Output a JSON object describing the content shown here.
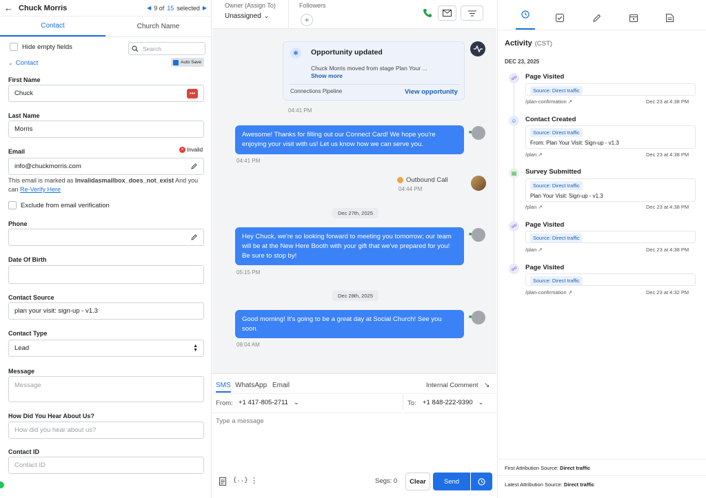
{
  "contact_header": {
    "name": "Chuck Morris",
    "current": "9 of",
    "total": "15",
    "selected_label": "selected"
  },
  "tabs": [
    "Contact",
    "Church Name"
  ],
  "toolbar": {
    "hide_empty": "Hide empty fields",
    "search_placeholder": "Search",
    "auto_save": "Auto Save",
    "section": "Contact"
  },
  "fields": {
    "first_name": {
      "label": "First Name",
      "value": "Chuck"
    },
    "last_name": {
      "label": "Last Name",
      "value": "Morris"
    },
    "email": {
      "label": "Email",
      "value": "info@chuckmorris.com",
      "badge": "Invalid",
      "note_a": "This email is marked as ",
      "note_bold": "Invalidasmailbox_does_not_exist",
      "note_b": " And you can ",
      "link": "Re-Verify Here"
    },
    "exclude_label": "Exclude from email verification",
    "phone": {
      "label": "Phone",
      "value": ""
    },
    "dob": {
      "label": "Date Of Birth",
      "value": ""
    },
    "source": {
      "label": "Contact Source",
      "value": "plan your visit: sign-up - v1.3"
    },
    "type": {
      "label": "Contact Type",
      "value": "Lead"
    },
    "message": {
      "label": "Message",
      "placeholder": "Message"
    },
    "hear": {
      "label": "How Did You Hear About Us?",
      "placeholder": "How did you hear about us?"
    },
    "cid": {
      "label": "Contact ID",
      "placeholder": "Contact ID"
    }
  },
  "mid_header": {
    "owner_label": "Owner (Assign To)",
    "owner_value": "Unassigned",
    "followers_label": "Followers"
  },
  "opportunity": {
    "title": "Opportunity updated",
    "text": "Chuck Morris moved from stage Plan Your ...",
    "show_more": "Show more",
    "pipeline": "Connections Pipeline",
    "view": "View opportunity",
    "time": "04:41 PM"
  },
  "messages": [
    {
      "text": "Awesome! Thanks for filling out our Connect Card! We hope you're enjoying your visit with us! Let us know how we can serve you.",
      "time": "04:41 PM"
    },
    {
      "text": "Hey Chuck, we're so looking forward to meeting you tomorrow; our team will be at the New Here Booth with your gift that we've prepared for you! Be sure to stop by!",
      "time": "05:15 PM"
    },
    {
      "text": "Good morning! It's going to be a great day at Social Church! See you soon.",
      "time": "08:04 AM"
    }
  ],
  "outbound": {
    "label": "Outbound Call",
    "time": "04:44 PM"
  },
  "dates": [
    "Dec 27th, 2025",
    "Dec 28th, 2025"
  ],
  "composer": {
    "tabs": [
      "SMS",
      "WhatsApp",
      "Email"
    ],
    "internal": "Internal Comment",
    "from_label": "From:",
    "from": "+1 417-805-2711",
    "to_label": "To:",
    "to": "+1 848-222-9390",
    "placeholder": "Type a message",
    "segs": "Segs: 0",
    "clear": "Clear",
    "send": "Send"
  },
  "activity": {
    "title": "Activity",
    "tz": "(CST)",
    "date": "DEC 23, 2025",
    "items": [
      {
        "title": "Page Visited",
        "source": "Source: Direct traffic",
        "extra": "",
        "link": "/plan-confirmation",
        "when": "Dec 23 at 4:38 PM"
      },
      {
        "title": "Contact Created",
        "source": "Source: Direct traffic",
        "extra": "From: Plan Your Visit: Sign-up - v1.3",
        "link": "/plan",
        "when": "Dec 23 at 4:38 PM"
      },
      {
        "title": "Survey Submitted",
        "source": "Source: Direct traffic",
        "extra": "Plan Your Visit: Sign-up - v1.3",
        "link": "/plan",
        "when": "Dec 23 at 4:38 PM"
      },
      {
        "title": "Page Visited",
        "source": "Source: Direct traffic",
        "extra": "",
        "link": "/plan",
        "when": "Dec 23 at 4:38 PM"
      },
      {
        "title": "Page Visited",
        "source": "Source: Direct traffic",
        "extra": "",
        "link": "/plan-confirmation",
        "when": "Dec 23 at 4:32 PM"
      }
    ]
  },
  "attribution": {
    "first_label": "First Attribution Source:",
    "first": "Direct traffic",
    "latest_label": "Latest Attribution Source:",
    "latest": "Direct traffic"
  },
  "colors": {
    "accent": "#1a6fe0",
    "bubble": "#3b82f6",
    "invalid": "#e53935"
  }
}
